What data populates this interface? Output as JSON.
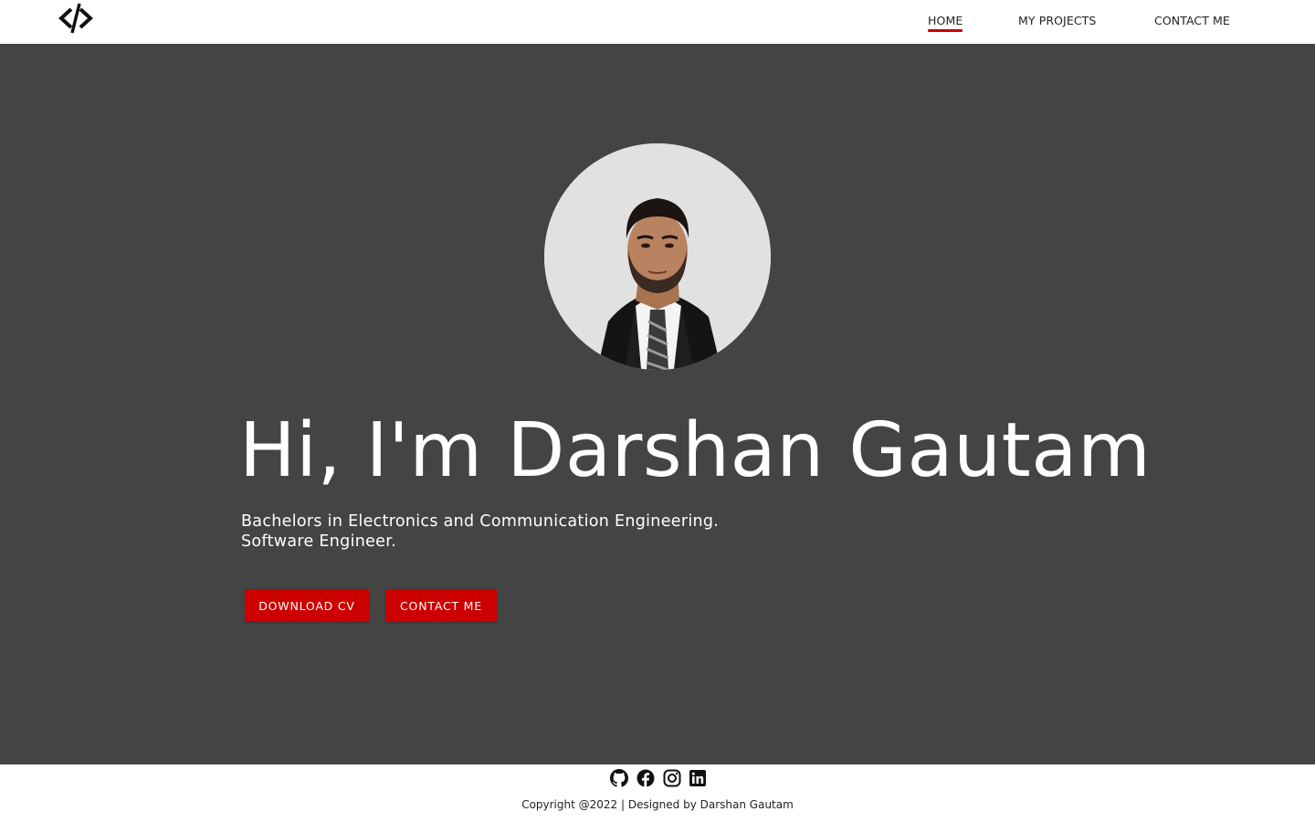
{
  "nav": {
    "logo_icon": "code-slash-logo-icon",
    "items": [
      {
        "label": "HOME",
        "active": true
      },
      {
        "label": "MY PROJECTS",
        "active": false
      },
      {
        "label": "CONTACT ME",
        "active": false
      }
    ]
  },
  "hero": {
    "avatar_icon": "profile-photo",
    "title": "Hi, I'm Darshan Gautam",
    "subtitle_lines": [
      "Bachelors in Electronics and Communication Engineering.",
      "Software Engineer."
    ],
    "buttons": {
      "download_cv": "DOWNLOAD CV",
      "contact_me": "CONTACT ME"
    }
  },
  "footer": {
    "social_icons": [
      "github-icon",
      "facebook-icon",
      "instagram-icon",
      "linkedin-icon"
    ],
    "copyright": "Copyright @2022 | Designed by Darshan Gautam"
  },
  "colors": {
    "accent": "#cc0000",
    "hero_background": "#444444",
    "header_background": "#ffffff",
    "text_light": "#ffffff",
    "text_dark": "#222222"
  }
}
